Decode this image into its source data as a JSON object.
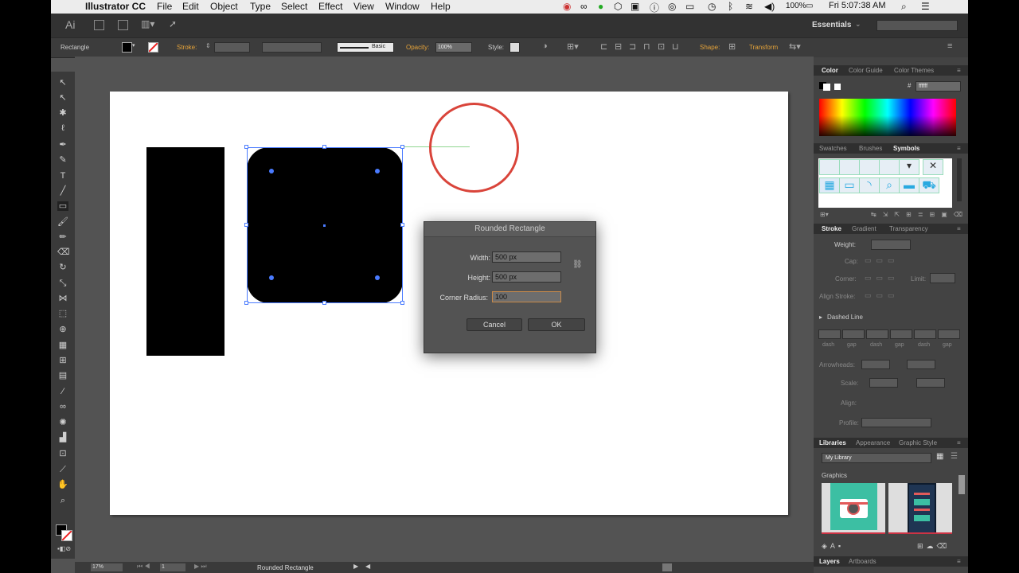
{
  "menubar": {
    "app": "Illustrator CC",
    "items": [
      "File",
      "Edit",
      "Object",
      "Type",
      "Select",
      "Effect",
      "View",
      "Window",
      "Help"
    ],
    "battery": "100%",
    "clock": "Fri 5:07:38 AM"
  },
  "appbar": {
    "logo": "Ai",
    "workspace": "Essentials"
  },
  "control": {
    "selection": "Rectangle",
    "stroke_label": "Stroke:",
    "brush": "Basic",
    "opacity_label": "Opacity:",
    "opacity_value": "100%",
    "style_label": "Style:",
    "shape_label": "Shape:",
    "transform_label": "Transform"
  },
  "dialog": {
    "title": "Rounded Rectangle",
    "width_label": "Width:",
    "width_value": "500 px",
    "height_label": "Height:",
    "height_value": "500 px",
    "radius_label": "Corner Radius:",
    "radius_value": "100",
    "cancel": "Cancel",
    "ok": "OK"
  },
  "panels": {
    "color_tabs": [
      "Color",
      "Color Guide",
      "Color Themes"
    ],
    "color_hex": "ffffff",
    "swatch_tabs": [
      "Swatches",
      "Brushes",
      "Symbols"
    ],
    "stroke_tabs": [
      "Stroke",
      "Gradient",
      "Transparency"
    ],
    "stroke": {
      "weight": "Weight:",
      "cap": "Cap:",
      "corner": "Corner:",
      "limit": "Limit:",
      "align": "Align Stroke:",
      "dashed": "Dashed Line",
      "dash_labels": [
        "dash",
        "gap",
        "dash",
        "gap",
        "dash",
        "gap"
      ],
      "arrowheads": "Arrowheads:",
      "scale": "Scale:",
      "align2": "Align:",
      "profile": "Profile:"
    },
    "lib_tabs": [
      "Libraries",
      "Appearance",
      "Graphic Style"
    ],
    "library": "My Library",
    "graphics": "Graphics",
    "layer_tabs": [
      "Layers",
      "Artboards"
    ]
  },
  "status": {
    "zoom": "17%",
    "artboard": "1",
    "tool": "Rounded Rectangle"
  },
  "colors": {
    "selection": "#4a7bff",
    "circle_stroke": "#d9443a",
    "guide": "#8fd68f"
  }
}
